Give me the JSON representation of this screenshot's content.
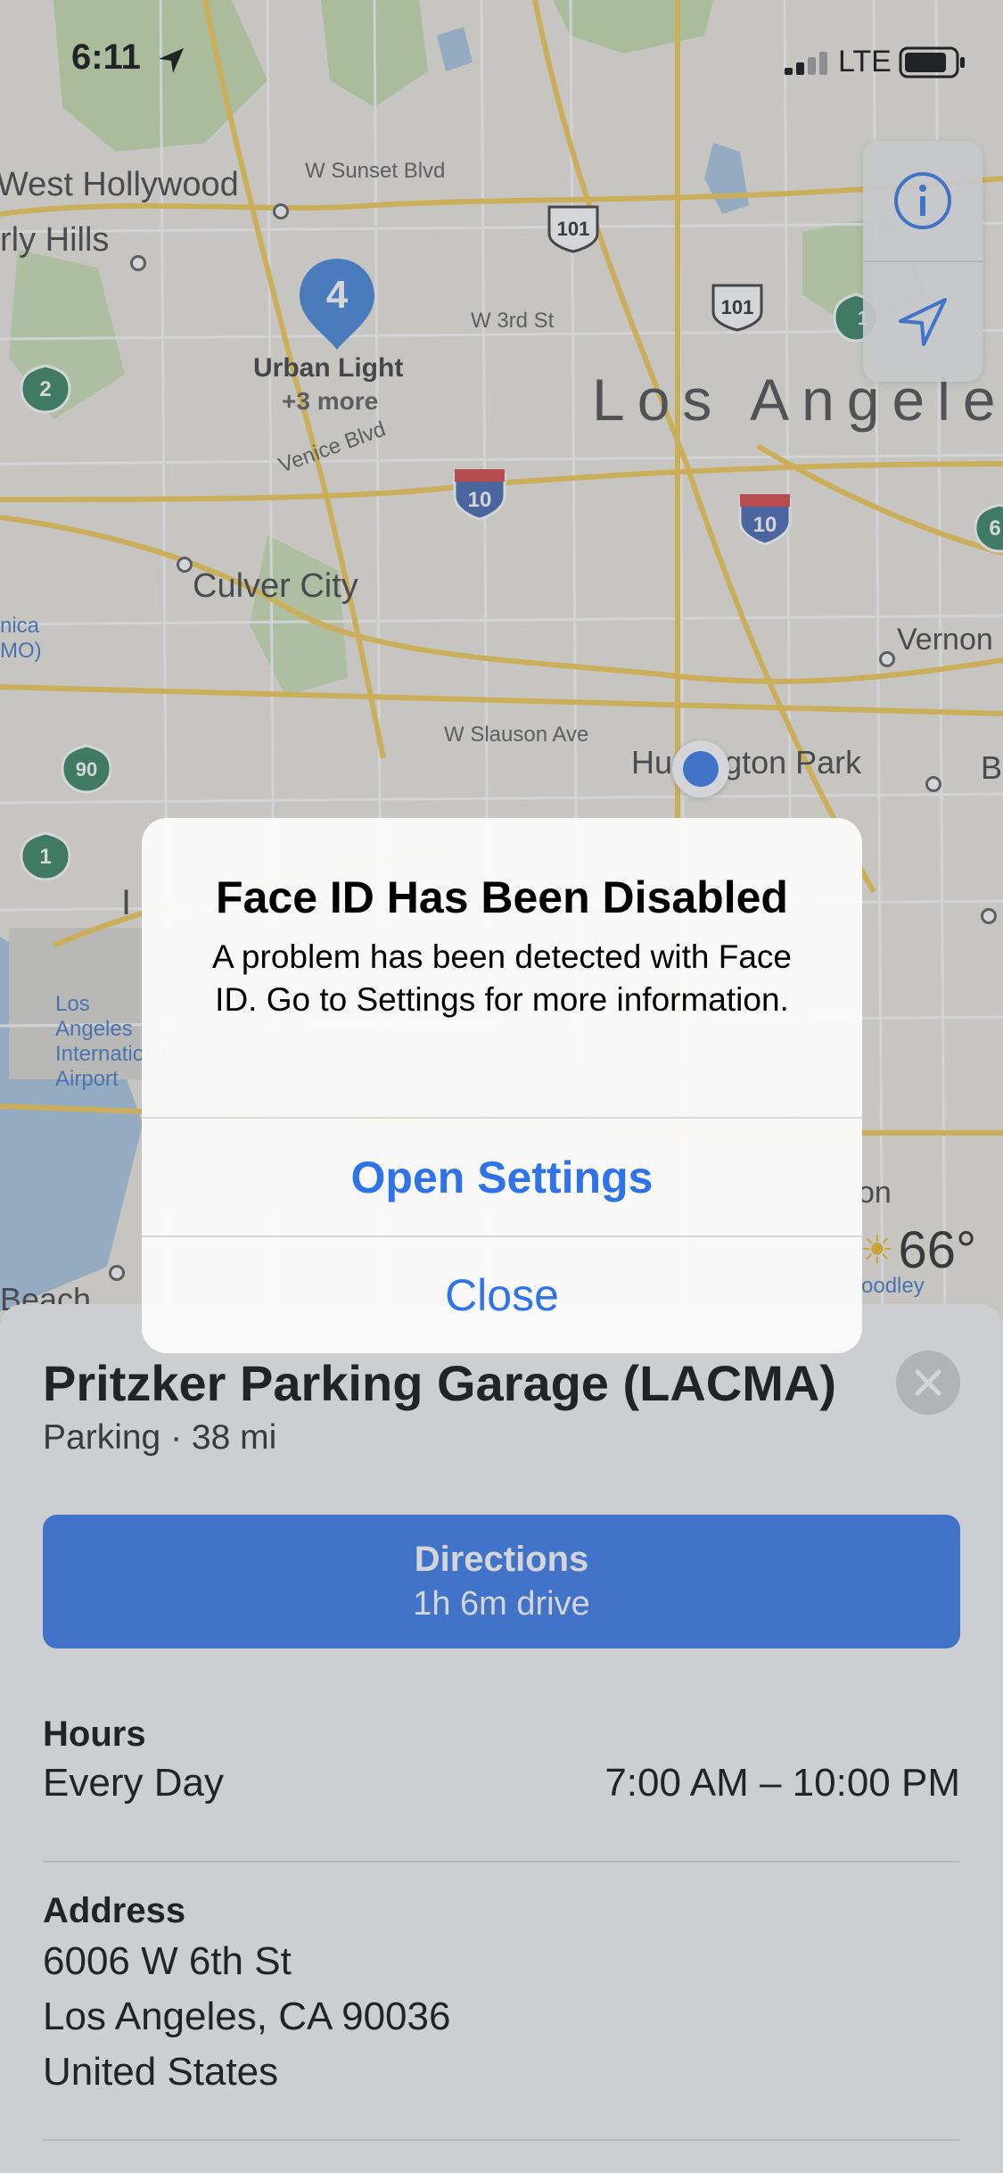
{
  "status_bar": {
    "time": "6:11",
    "network": "LTE"
  },
  "map": {
    "labels": {
      "west_hollywood": "West Hollywood",
      "beverly_hills": "rly Hills",
      "sunset": "W Sunset Blvd",
      "third_st": "W 3rd St",
      "los_angeles": "Los Angeles",
      "venice": "Venice Blvd",
      "culver_city": "Culver City",
      "vernon": "Vernon",
      "slauson": "W Slauson Ave",
      "huntington_park": "Huntington Park",
      "lax": "Los Angeles International Airport",
      "santa_monica": "nica MO)",
      "beach": "Beach",
      "on": "on",
      "goodley": "oodley",
      "b": "B",
      "i_letter": "I"
    },
    "pin": {
      "count": "4",
      "title": "Urban Light",
      "subtitle": "+3 more"
    },
    "shields": [
      "101",
      "101",
      "10",
      "10",
      "2",
      "90",
      "1",
      "1",
      "6"
    ],
    "weather": {
      "temp": "66°"
    }
  },
  "controls": {
    "info_icon": "info-icon",
    "location_icon": "location-arrow-icon"
  },
  "place": {
    "title": "Pritzker Parking Garage (LACMA)",
    "subtitle": "Parking · 38 mi",
    "directions_label": "Directions",
    "directions_sub": "1h 6m drive",
    "hours_heading": "Hours",
    "hours_days": "Every Day",
    "hours_value": "7:00 AM – 10:00 PM",
    "address_heading": "Address",
    "address_line1": "6006 W 6th St",
    "address_line2": "Los Angeles, CA  90036",
    "address_line3": "United States"
  },
  "alert": {
    "title": "Face ID Has Been Disabled",
    "message": "A problem has been detected with Face ID. Go to Settings for more information.",
    "open_settings": "Open Settings",
    "close": "Close"
  },
  "colors": {
    "accent": "#2f73ea",
    "map_bg": "#e9e6dc",
    "park": "#b9d99b",
    "road": "#f2c84b",
    "freeway_shield": "#3d5fae"
  }
}
